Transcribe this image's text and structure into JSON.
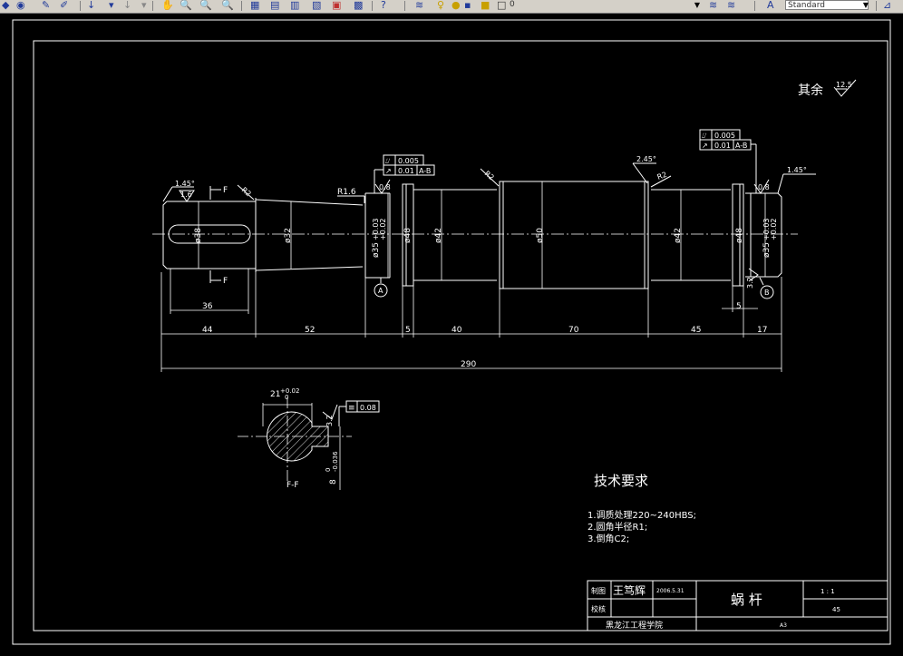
{
  "toolbar": {
    "icons": [
      "match-properties-icon",
      "paint-icon",
      "pencil-icon",
      "undo-icon",
      "redo-icon",
      "pan-icon",
      "zoom-realtime-icon",
      "zoom-window-icon",
      "zoom-previous-icon",
      "properties-icon",
      "design-center-icon",
      "tool-palette-icon",
      "sheet-set-icon",
      "markup-icon",
      "calculator-icon",
      "help-icon",
      "layers-icon",
      "lightbulb-icon",
      "sun-icon",
      "lock-icon",
      "color-icon"
    ],
    "layer_value": "0",
    "text_style": "Standard"
  },
  "drawing": {
    "roughness_note": "其余",
    "roughness_value": "12.5",
    "dims": {
      "d44": "44",
      "d52": "52",
      "d5a": "5",
      "d40": "40",
      "d70": "70",
      "d45": "45",
      "d17": "17",
      "d5b": "5",
      "d36": "36",
      "d290": "290"
    },
    "diameters": {
      "dia_key": "ø38",
      "dia32": "ø32",
      "dia35_left": "ø35",
      "dia48_left": "ø48",
      "dia42_left": "ø42",
      "dia50": "ø50",
      "dia42_right": "ø42",
      "dia48_right": "ø48",
      "dia35_right": "ø35",
      "tol_upper": "+0.03",
      "tol_lower": "+0.02"
    },
    "chamfers": {
      "c1": "1.45°",
      "c2": "2.45°",
      "c3": "1.45°"
    },
    "radii": {
      "r1": "R2",
      "r2": "R1.6",
      "r3": "R2",
      "r4": "R2"
    },
    "roughness": {
      "ra1": "1.6",
      "ra2": "0.8",
      "ra3": "0.8",
      "ra4": "3.2"
    },
    "tolerance_frames": {
      "left_runout": "0.005",
      "left_circ": "0.01",
      "left_datum": "A-B",
      "right_runout": "0.005",
      "right_circ": "0.01",
      "right_datum": "A-B",
      "section_sym": "0.08"
    },
    "datums": {
      "a": "A",
      "b": "B"
    },
    "section_labels": {
      "cut1": "F",
      "cut2": "F",
      "section_name": "F-F",
      "keyway_width": "21",
      "kw_upper": "+0.02",
      "kw_lower": "0",
      "keyway_depth": "8",
      "depth_upper": "0",
      "depth_lower": "-0.036",
      "side_rough": "3.2"
    },
    "tech": {
      "heading": "技术要求",
      "lines": [
        "1.调质处理220~240HBS;",
        "2.圆角半径R1;",
        "3.倒角C2;"
      ]
    },
    "title_block": {
      "drawn_label": "制图",
      "drawer": "王笃辉",
      "date": "2006.5.31",
      "check_label": "校核",
      "part_name": "蜗 杆",
      "scale": "1 : 1",
      "material": "45",
      "school": "黑龙江工程学院",
      "sheet": "A3"
    }
  }
}
